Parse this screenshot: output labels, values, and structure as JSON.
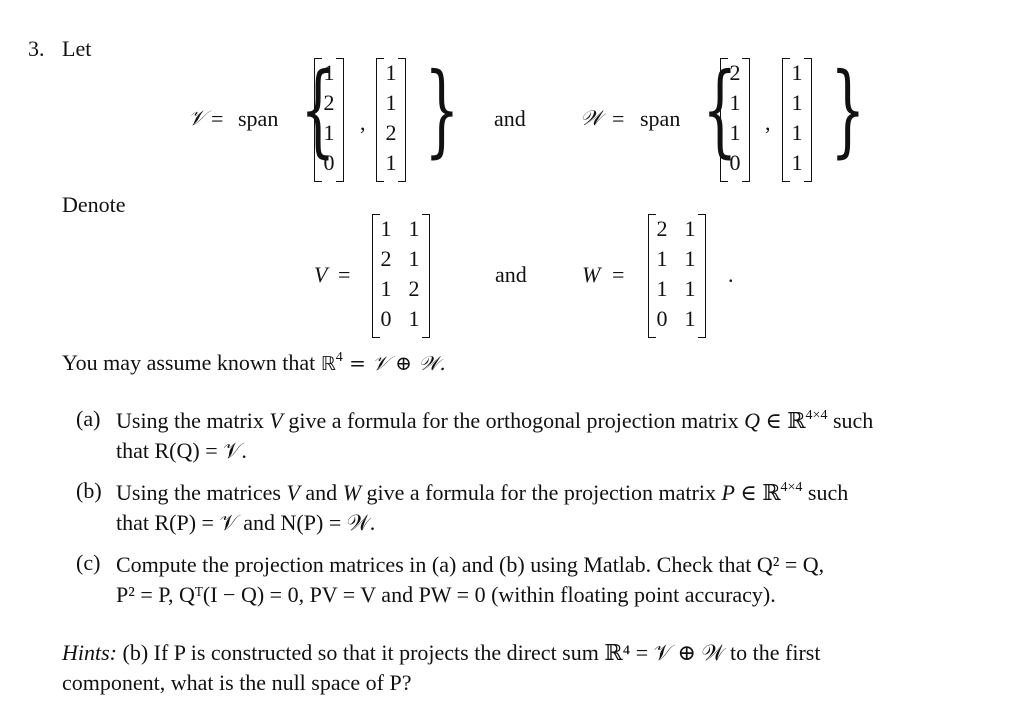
{
  "problem": {
    "number": "3.",
    "intro": "Let",
    "denote": "Denote",
    "span_word": "span",
    "and_word": "and",
    "V_subspace_symbol": "𝒱",
    "W_subspace_symbol": "𝒲",
    "V_matrix_symbol": "V",
    "W_matrix_symbol": "W",
    "equals": "=",
    "comma": ",",
    "period": ".",
    "V_vectors": [
      [
        1,
        2,
        1,
        0
      ],
      [
        1,
        1,
        2,
        1
      ]
    ],
    "W_vectors": [
      [
        2,
        1,
        1,
        0
      ],
      [
        1,
        1,
        1,
        1
      ]
    ],
    "V_matrix": [
      [
        1,
        1
      ],
      [
        2,
        1
      ],
      [
        1,
        2
      ],
      [
        0,
        1
      ]
    ],
    "W_matrix": [
      [
        2,
        1
      ],
      [
        1,
        1
      ],
      [
        1,
        1
      ],
      [
        0,
        1
      ]
    ],
    "assumption": {
      "text": "You may assume known that ",
      "math": "ℝ",
      "exp": "4",
      "rest": " = 𝒱 ⊕ 𝒲."
    }
  },
  "parts": [
    {
      "label": "(a)",
      "line1_a": "Using the matrix ",
      "line1_var": "V",
      "line1_b": " give a formula for the orthogonal projection matrix ",
      "line1_var2": "Q",
      "line1_c": " ∈ ℝ",
      "line1_exp": "4×4",
      "line1_d": " such",
      "line2": "that R(Q) = 𝒱."
    },
    {
      "label": "(b)",
      "line1_a": "Using the matrices ",
      "line1_var": "V",
      "line1_mid": " and ",
      "line1_var_b": "W",
      "line1_b": " give a formula for the projection matrix ",
      "line1_var2": "P",
      "line1_c": " ∈ ℝ",
      "line1_exp": "4×4",
      "line1_d": " such",
      "line2": "that R(P) = 𝒱 and N(P) = 𝒲."
    },
    {
      "label": "(c)",
      "line1": "Compute the projection matrices in (a) and (b) using Matlab. Check that Q² = Q,",
      "line2": "P² = P, Qᵀ(I − Q) = 0, PV = V and PW = 0 (within floating point accuracy)."
    }
  ],
  "hints": {
    "label": "Hints:",
    "line1": " (b) If P is constructed so that it projects the direct sum ℝ⁴ = 𝒱 ⊕ 𝒲 to the first",
    "line2": "component, what is the null space of P?"
  }
}
